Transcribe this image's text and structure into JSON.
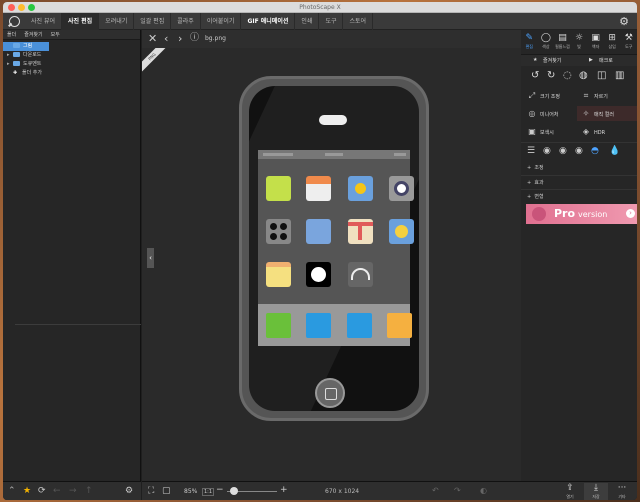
{
  "window": {
    "title": "PhotoScape X"
  },
  "menu": {
    "tabs": [
      {
        "label": "사진 뷰어"
      },
      {
        "label": "사진 편집"
      },
      {
        "label": "오려내기"
      },
      {
        "label": "일괄 편집"
      },
      {
        "label": "콜라주"
      },
      {
        "label": "이어붙이기"
      },
      {
        "label": "GIF 애니메이션"
      },
      {
        "label": "인쇄"
      },
      {
        "label": "도구"
      },
      {
        "label": "스토어"
      }
    ],
    "active_tab": "사진 편집"
  },
  "left": {
    "tabs": [
      "폴더",
      "즐겨찾기",
      "모두"
    ],
    "tree": [
      {
        "label": "그림",
        "selected": true
      },
      {
        "label": "다운로드"
      },
      {
        "label": "도큐멘트"
      },
      {
        "label": "폴더 추가"
      }
    ]
  },
  "canvas": {
    "filename": "bg.png",
    "ribbon": "PNG",
    "zoom": "85%",
    "zoom_fit": "1:1",
    "dimensions": "670 x 1024"
  },
  "right": {
    "tools": [
      {
        "label": "편집",
        "icon": "edit-icon"
      },
      {
        "label": "색상",
        "icon": "color-icon"
      },
      {
        "label": "필름느낌",
        "icon": "film-icon"
      },
      {
        "label": "빛",
        "icon": "light-icon"
      },
      {
        "label": "액자",
        "icon": "frame-icon"
      },
      {
        "label": "삽입",
        "icon": "insert-icon"
      },
      {
        "label": "도구",
        "icon": "tools-icon"
      }
    ],
    "sub": {
      "favorites": "즐겨찾기",
      "macro": "매크로"
    },
    "grid": [
      {
        "label": "크기 조정"
      },
      {
        "label": "자르기"
      },
      {
        "label": "미니어처"
      },
      {
        "label": "매직 컬러"
      },
      {
        "label": "보색시"
      },
      {
        "label": "HDR"
      }
    ],
    "sections": [
      {
        "label": "조정"
      },
      {
        "label": "효과"
      },
      {
        "label": "변형"
      }
    ],
    "banner": {
      "pro": "Pro",
      "version": "version"
    },
    "bottom": [
      {
        "label": "열기"
      },
      {
        "label": "저장"
      },
      {
        "label": "기타"
      }
    ]
  },
  "colors": {
    "accent": "#4a90d9",
    "banner": "#e07090"
  }
}
